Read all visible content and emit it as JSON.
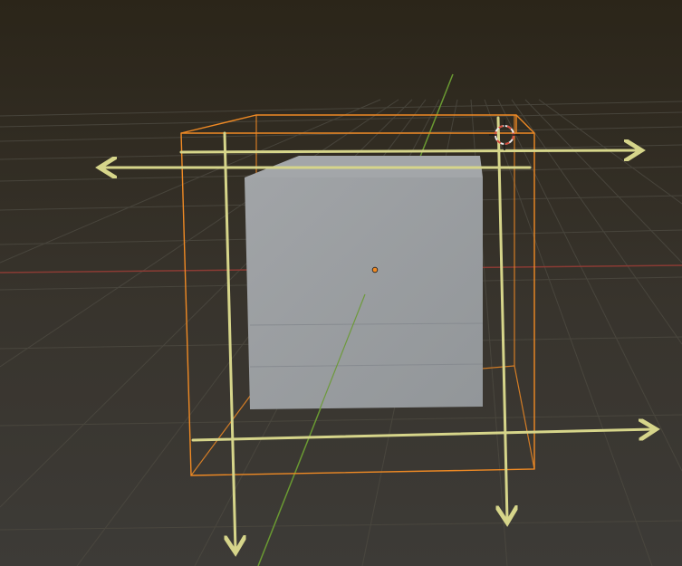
{
  "colors": {
    "background_top": "#2d2a23",
    "background_bottom": "#3c3a36",
    "grid_line": "#4f4c45",
    "x_axis": "#8a3b34",
    "y_axis": "#6a9a32",
    "bounding_box": "#f08a24",
    "cube_face": "#9b9fa2",
    "cube_face_top": "#a0a4a7",
    "cube_edge": "#81858a",
    "origin_dot": "#f08a24",
    "arrow_gizmo": "#d6d58a",
    "cursor_red": "#d54a3a",
    "cursor_white": "#eeeeee"
  },
  "icons": {
    "cursor": "3d-cursor-icon",
    "origin": "object-origin-icon"
  },
  "scene": {
    "selected_object": "cube",
    "gizmo": "scale-arrows"
  }
}
